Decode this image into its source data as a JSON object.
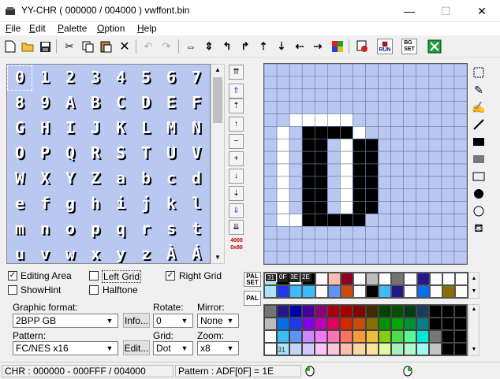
{
  "window": {
    "title": "YY-CHR ( 000000 / 004000 ) vwffont.bin",
    "minimize": "—",
    "maximize": "☐",
    "close": "✕"
  },
  "menu": [
    {
      "label": "File",
      "key": "F",
      "rest": "ile"
    },
    {
      "label": "Edit",
      "key": "E",
      "rest": "dit"
    },
    {
      "label": "Palette",
      "key": "P",
      "rest": "alette"
    },
    {
      "label": "Option",
      "key": "O",
      "rest": "ption"
    },
    {
      "label": "Help",
      "key": "H",
      "rest": "elp"
    }
  ],
  "toolbar": [
    "new-file-icon",
    "open-folder-icon",
    "save-icon",
    "cut-icon",
    "copy-icon",
    "paste-icon",
    "delete-icon",
    "undo-icon",
    "redo-icon",
    "flip-horizontal-icon",
    "flip-vertical-icon",
    "rotate-left-icon",
    "rotate-right-icon",
    "shift-up-icon",
    "shift-down-icon",
    "shift-left-icon",
    "shift-right-icon",
    "color-replace-icon",
    "properties-icon",
    "run-icon",
    "bgset-icon",
    "bookmark-icon"
  ],
  "toolbar_text": {
    "run": "RUN",
    "bgset": "BG\nSET"
  },
  "chr_rows": [
    [
      "0",
      "1",
      "2",
      "3",
      "4",
      "5",
      "6",
      "7"
    ],
    [
      "8",
      "9",
      "A",
      "B",
      "C",
      "D",
      "E",
      "F"
    ],
    [
      "G",
      "H",
      "I",
      "J",
      "K",
      "L",
      "M",
      "N"
    ],
    [
      "O",
      "P",
      "Q",
      "R",
      "S",
      "T",
      "U",
      "V"
    ],
    [
      "W",
      "X",
      "Y",
      "Z",
      "a",
      "b",
      "c",
      "d"
    ],
    [
      "e",
      "f",
      "g",
      "h",
      "i",
      "j",
      "k",
      "l"
    ],
    [
      "m",
      "n",
      "o",
      "p",
      "q",
      "r",
      "s",
      "t"
    ],
    [
      "u",
      "v",
      "w",
      "x",
      "y",
      "z",
      "À",
      "Á"
    ]
  ],
  "nav": {
    "buttons": [
      "⇈",
      "⇑",
      "⇡",
      "↑",
      "−",
      "+",
      "↓",
      "⇣",
      "⇓",
      "⇊"
    ],
    "address": "4000\n0x80"
  },
  "options": {
    "editing_area": {
      "label": "Editing Area",
      "checked": true
    },
    "left_grid": {
      "label": "Left Grid",
      "checked": false
    },
    "right_grid": {
      "label": "Right Grid",
      "checked": true
    },
    "show_hint": {
      "label": "ShowHint",
      "checked": false
    },
    "halftone": {
      "label": "Halftone",
      "checked": false
    }
  },
  "graphic_format": {
    "label": "Graphic format:",
    "value": "2BPP GB",
    "info_button": "Info..."
  },
  "rotate": {
    "label": "Rotate:",
    "value": "0"
  },
  "mirror": {
    "label": "Mirror:",
    "value": "None"
  },
  "pattern": {
    "label": "Pattern:",
    "value": "FC/NES x16",
    "edit_button": "Edit..."
  },
  "grid": {
    "label": "Grid:",
    "value": "Dot"
  },
  "zoom": {
    "label": "Zoom:",
    "value": "x8"
  },
  "palette": {
    "set_button": "PAL\nSET",
    "pal_button": "PAL",
    "chips": [
      "31",
      "0F",
      "3E",
      "2E"
    ],
    "big_label": "31"
  },
  "palette_colors": [
    "#747474",
    "#24188c",
    "#0000a8",
    "#44009c",
    "#8c0074",
    "#a80010",
    "#a40000",
    "#7c0800",
    "#402c00",
    "#004400",
    "#005000",
    "#003c14",
    "#183c5c",
    "#000000",
    "#000000",
    "#000000",
    "#bcbcbc",
    "#0070ec",
    "#2038ec",
    "#8000f0",
    "#bc00bc",
    "#e40058",
    "#d82800",
    "#c84c0c",
    "#887000",
    "#009400",
    "#00a800",
    "#009038",
    "#008088",
    "#000000",
    "#000000",
    "#000000",
    "#fcfcfc",
    "#3cbcfc",
    "#5c94fc",
    "#cc88fc",
    "#f478fc",
    "#fc74b4",
    "#fc7460",
    "#fc9838",
    "#f0bc3c",
    "#80d010",
    "#4cdc48",
    "#58f898",
    "#00e8d8",
    "#787878",
    "#000000",
    "#000000",
    "#fcfcfc",
    "#a8e4fc",
    "#c4d4fc",
    "#d4c8fc",
    "#fcc4fc",
    "#fcc4d8",
    "#fcbcb0",
    "#fcd8a8",
    "#fce4a0",
    "#e0fca0",
    "#a8f0bc",
    "#b0fccc",
    "#9cfcf0",
    "#c4c4c4",
    "#000000",
    "#000000"
  ],
  "pal_row1": [
    "#a8e4fc",
    "#000000",
    "#fcfcfc",
    "#000000",
    "#fcfcfc",
    "#fcbcb0",
    "#8c0020",
    "#fcfcfc",
    "#bcbcbc",
    "#fcfcfc",
    "#747474",
    "#fcfcfc",
    "#24188c",
    "#fcfcfc",
    "#fcfcfc",
    "#fcfcfc"
  ],
  "pal_row2": [
    "#a8e4fc",
    "#2038ec",
    "#3cbcfc",
    "#3cbcfc",
    "#fcfcfc",
    "#5c94fc",
    "#c84c0c",
    "#fcfcfc",
    "#000000",
    "#3cbcfc",
    "#24188c",
    "#fcfcfc",
    "#0070ec",
    "#fcfcfc",
    "#887000",
    "#fcfcfc"
  ],
  "status": {
    "chr": "CHR : 000000 - 000FFF / 004000",
    "pattern": "Pattern : ADF[0F] = 1E"
  },
  "colors": {
    "chr_bg": "#b8c8f0",
    "grid_cell": "#b8c8f0",
    "accent": "#0078d7"
  }
}
